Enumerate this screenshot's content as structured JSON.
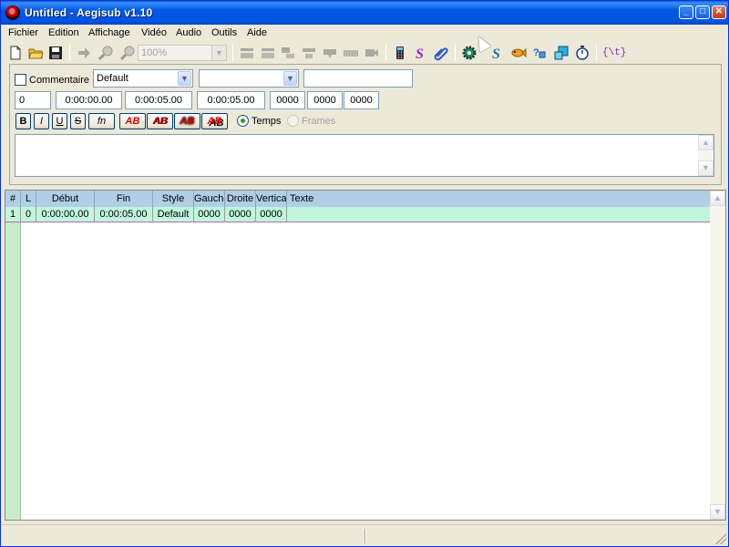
{
  "window": {
    "title": "Untitled - Aegisub v1.10"
  },
  "menu": [
    "Fichier",
    "Edition",
    "Affichage",
    "Vidéo",
    "Audio",
    "Outils",
    "Aide"
  ],
  "toolbar": {
    "zoom_value": "100%",
    "icons": [
      "new-file-icon",
      "open-folder-icon",
      "save-icon",
      "jump-to-icon",
      "zoom-in-icon",
      "zoom-out-icon",
      "snap-start-icon",
      "snap-end-icon",
      "snap-scene-icon",
      "snap-start-end-icon",
      "snap-video-icon",
      "keyframe-bar-icon",
      "video-camera-icon",
      "properties-icon",
      "styles-manager-icon",
      "attachments-icon",
      "automation-icon",
      "translation-icon",
      "fish-icon",
      "assistant-icon",
      "resample-icon",
      "timing-icon",
      "ass-tags-icon"
    ],
    "tags_label": "{\\t}"
  },
  "edit": {
    "comment_label": "Commentaire",
    "style_value": "Default",
    "actor_value": "",
    "effect_value": "",
    "layer": "0",
    "start_time": "0:00:00.00",
    "end_time": "0:00:05.00",
    "duration": "0:00:05.00",
    "margin_left": "0000",
    "margin_right": "0000",
    "margin_vertical": "0000",
    "format_buttons": [
      "B",
      "I",
      "U",
      "S",
      "fn"
    ],
    "color_buttons": [
      "AB",
      "AB",
      "AB",
      "AB"
    ],
    "radio_time": "Temps",
    "radio_frames": "Frames",
    "text_value": ""
  },
  "grid": {
    "headers": [
      "#",
      "L",
      "Début",
      "Fin",
      "Style",
      "Gauche",
      "Droite",
      "Vertical",
      "Texte"
    ],
    "rows": [
      {
        "num": "1",
        "layer": "0",
        "start": "0:00:00.00",
        "end": "0:00:05.00",
        "style": "Default",
        "left": "0000",
        "right": "0000",
        "vertical": "0000",
        "text": ""
      }
    ]
  },
  "colors": {
    "title_bar": "#0055e0",
    "grid_header": "#b0cfe6",
    "grid_row": "#c0f6dc",
    "row_gutter": "#c8ecc8"
  }
}
